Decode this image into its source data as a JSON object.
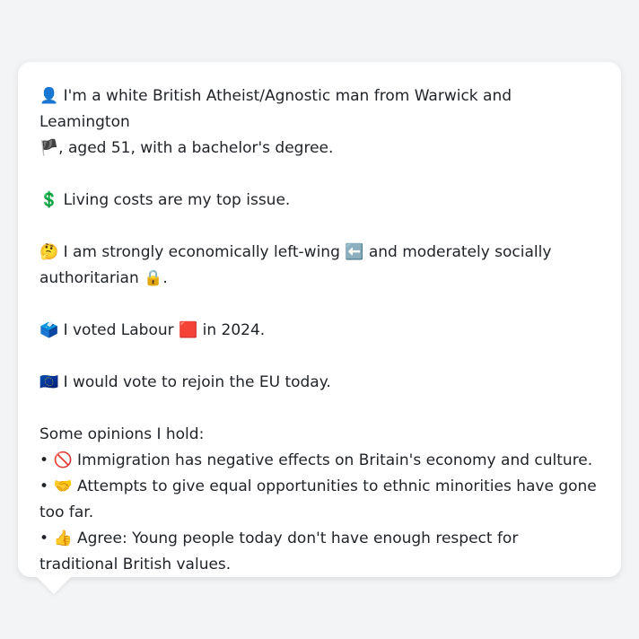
{
  "profile": {
    "intro_icon": "👤",
    "intro_text": "I'm a white British Atheist/Agnostic man from Warwick and Leamington",
    "intro_flag": "🏴",
    "intro_text2": ", aged 51, with a bachelor's degree.",
    "issue_icon": "💲",
    "issue_text": "Living costs are my top issue.",
    "politics_icon": "🤔",
    "politics_text1": "I am strongly economically left-wing",
    "politics_icon2": "⬅️",
    "politics_text2": "and moderately socially",
    "politics_text3": "authoritarian",
    "politics_icon3": "🔒",
    "politics_text4": ".",
    "vote_icon": "🗳️",
    "vote_text1": "I voted Labour",
    "vote_icon2": "🟥",
    "vote_text2": "in 2024.",
    "eu_icon": "🇪🇺",
    "eu_text": "I would vote to rejoin the EU today."
  },
  "opinions": {
    "heading": "Some opinions I hold:",
    "items": [
      {
        "bullet": "•",
        "icon": "🚫",
        "text": "Immigration has negative effects on Britain's economy and culture."
      },
      {
        "bullet": "•",
        "icon": "🤝",
        "text": "Attempts to give equal opportunities to ethnic minorities have gone too far."
      },
      {
        "bullet": "•",
        "icon": "👍",
        "text": "Agree: Young people today don't have enough respect for traditional British values."
      }
    ]
  }
}
